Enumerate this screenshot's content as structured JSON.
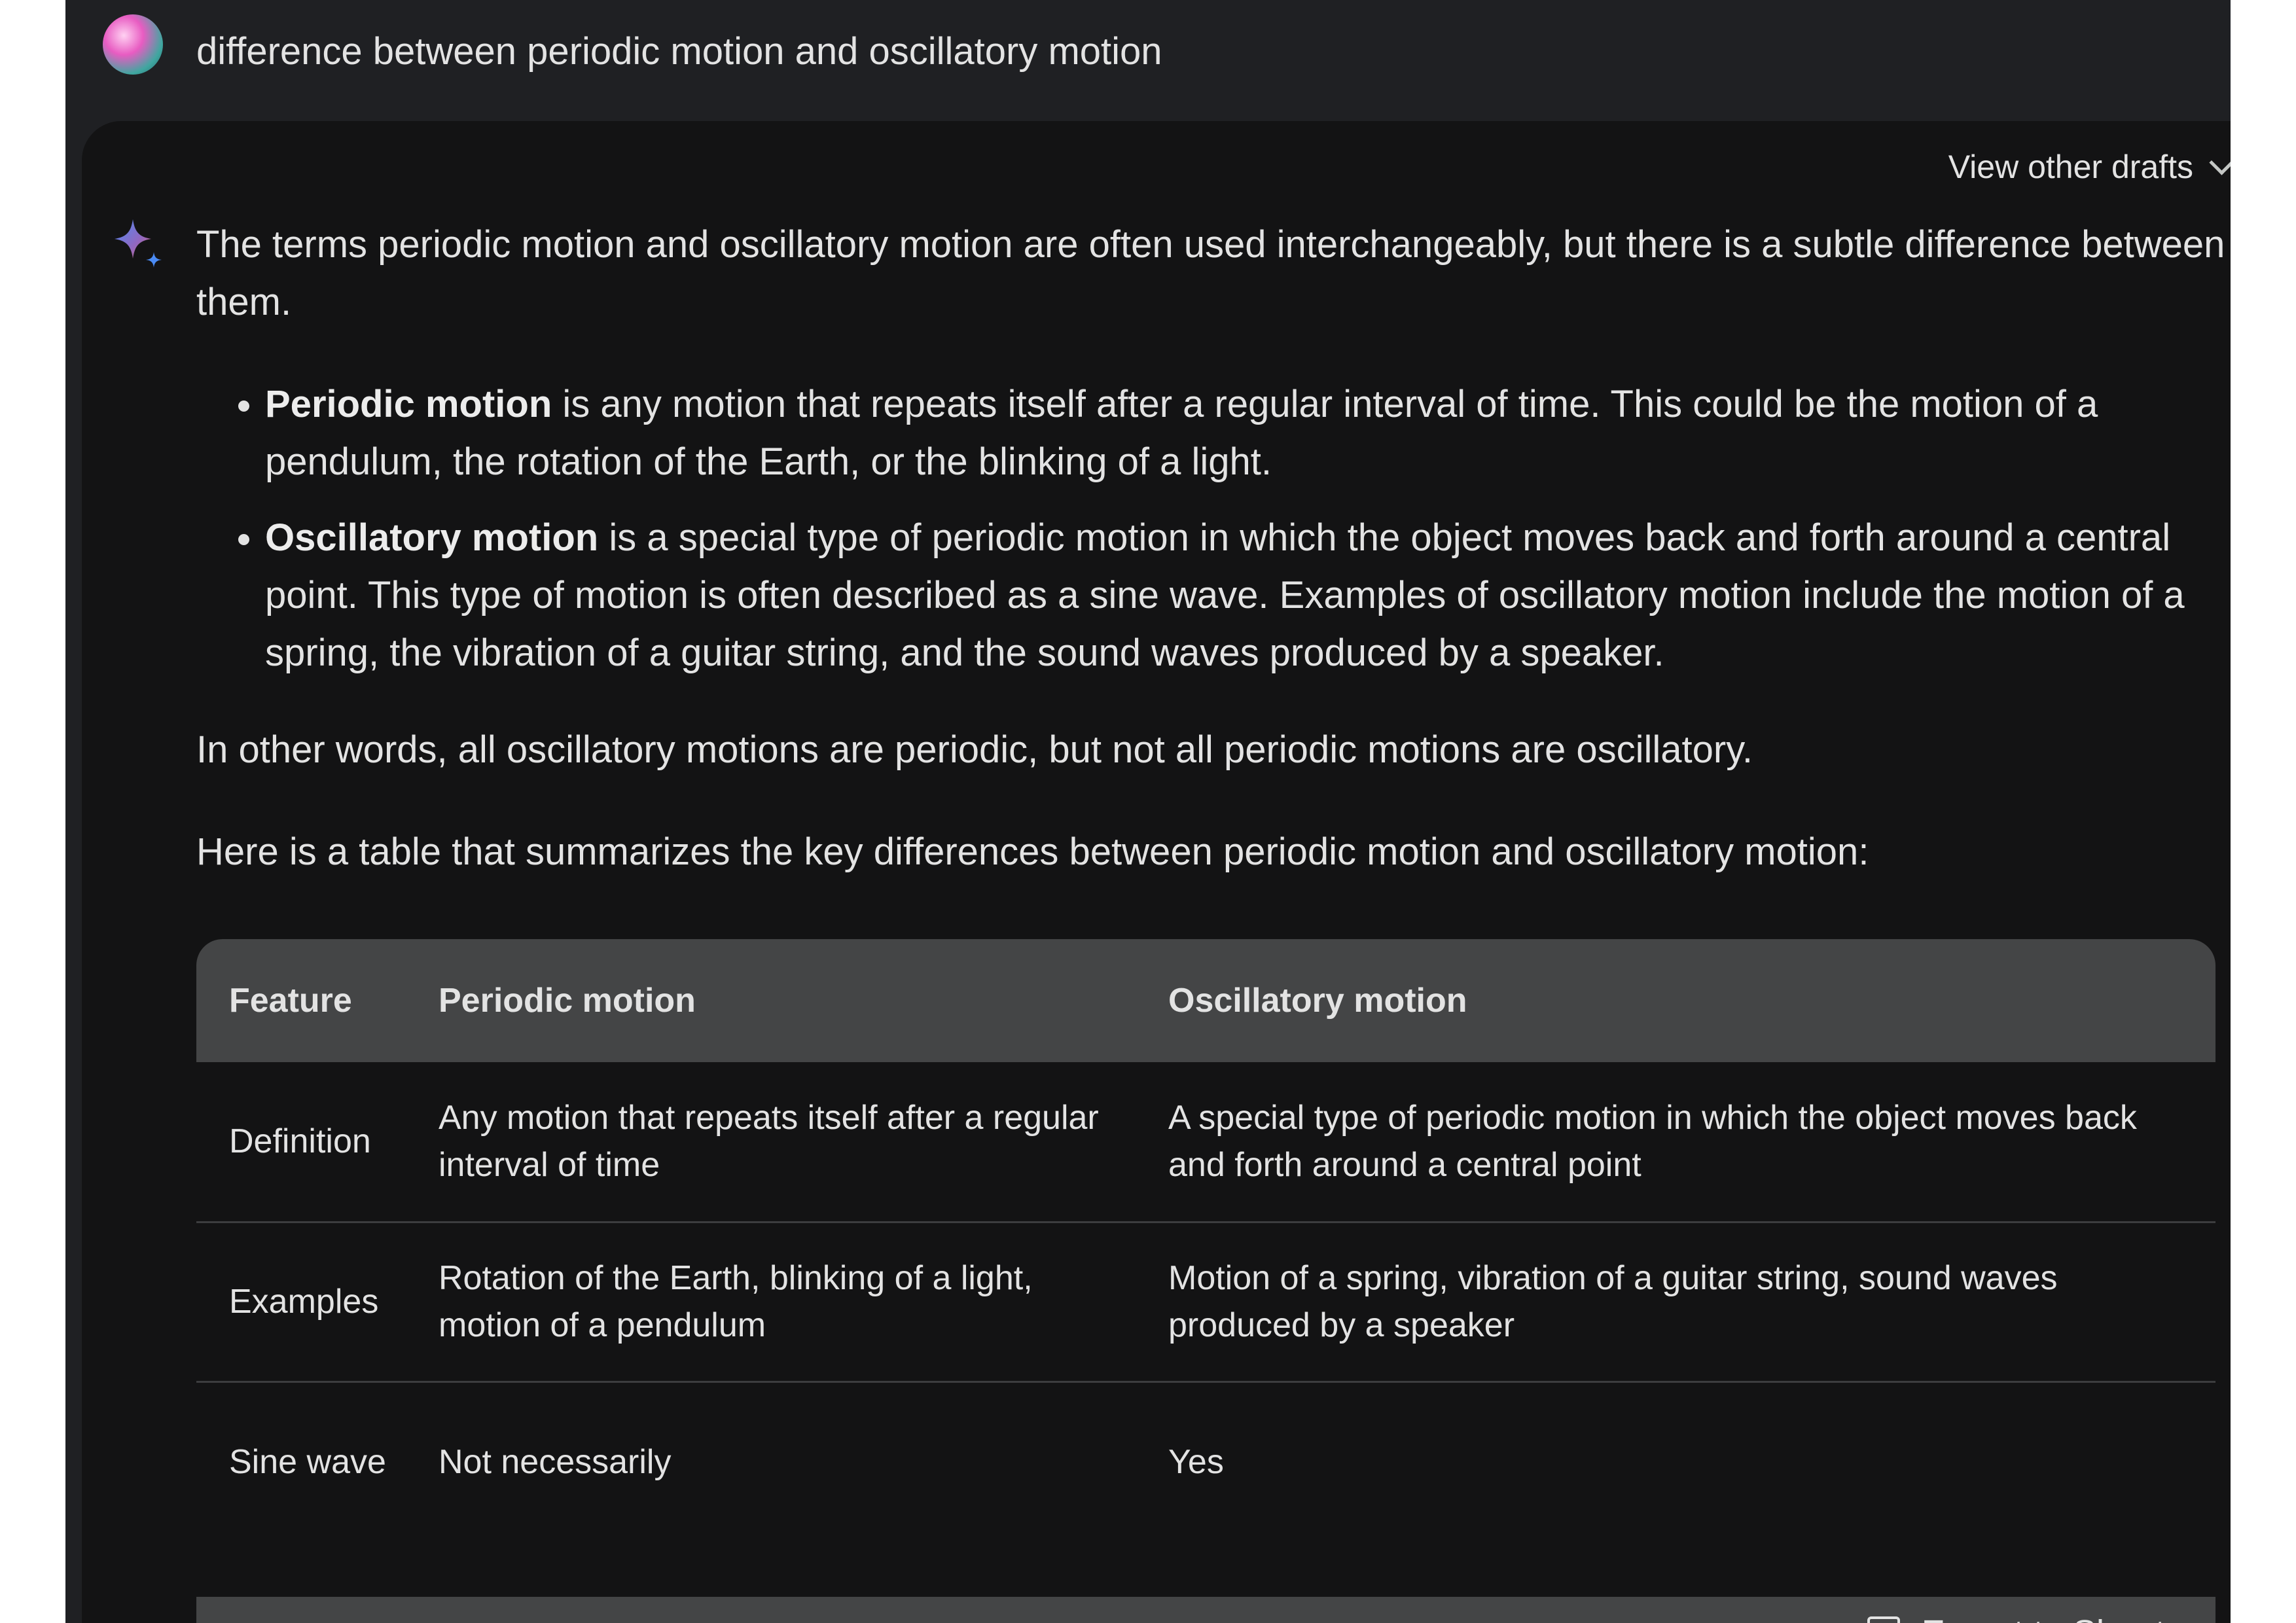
{
  "prompt": {
    "text": "difference between periodic motion and oscillatory motion"
  },
  "response": {
    "drafts_label": "View other drafts",
    "intro": "The terms periodic motion and oscillatory motion are often used interchangeably, but there is a subtle difference between them.",
    "points": [
      {
        "term": "Periodic motion",
        "text": " is any motion that repeats itself after a regular interval of time. This could be the motion of a pendulum, the rotation of the Earth, or the blinking of a light."
      },
      {
        "term": "Oscillatory motion",
        "text": " is a special type of periodic motion in which the object moves back and forth around a central point. This type of motion is often described as a sine wave. Examples of oscillatory motion include the motion of a spring, the vibration of a guitar string, and the sound waves produced by a speaker."
      }
    ],
    "summary": "In other words, all oscillatory motions are periodic, but not all periodic motions are oscillatory.",
    "table_intro": "Here is a table that summarizes the key differences between periodic motion and oscillatory motion:"
  },
  "table": {
    "headers": [
      "Feature",
      "Periodic motion",
      "Oscillatory motion"
    ],
    "rows": [
      [
        "Definition",
        "Any motion that repeats itself after a regular interval of time",
        "A special type of periodic motion in which the object moves back and forth around a central point"
      ],
      [
        "Examples",
        "Rotation of the Earth, blinking of a light, motion of a pendulum",
        "Motion of a spring, vibration of a guitar string, sound waves produced by a speaker"
      ],
      [
        "Sine wave",
        "Not necessarily",
        "Yes"
      ]
    ],
    "export_label": "Export to Sheets"
  },
  "icons": {
    "avatar": "user-avatar",
    "sparkle": "gemini-sparkle-icon",
    "chevron": "chevron-down-icon",
    "sheet": "table-sheet-icon"
  },
  "colors": {
    "background": "#131314",
    "header_bar": "#1f2023",
    "table_header": "#444546",
    "text": "#e3e3e3",
    "sparkle_blue": "#4b8bf5",
    "sparkle_pink": "#d96570"
  }
}
